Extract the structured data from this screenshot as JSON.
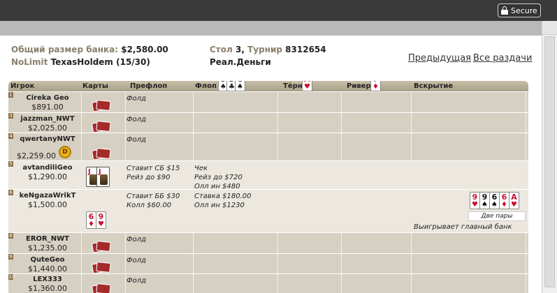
{
  "window": {
    "secure_label": "Secure"
  },
  "header": {
    "pot_label": "Общий размер банка:",
    "pot_value": "$2,580.00",
    "game_label": "NoLimit",
    "game_value": "TexasHoldem (15/30)",
    "table_label": "Стол",
    "table_value": "3,",
    "tournament_label": "Турнир",
    "tournament_value": "8312654",
    "money_type": "Реал.Деньги",
    "prev_link": "Предыдущая",
    "all_link": "Все раздачи"
  },
  "columns": {
    "player": "Игрок",
    "cards": "Карты",
    "preflop": "Префлоп",
    "flop": "Флоп",
    "turn": "Тёрн",
    "river": "Ривер",
    "showdown": "Вскрытие"
  },
  "board": {
    "flop": [
      {
        "v": "9",
        "s": "♠",
        "color": "#111111"
      },
      {
        "v": "3",
        "s": "♣",
        "color": "#111111"
      },
      {
        "v": "6",
        "s": "♠",
        "color": "#111111"
      }
    ],
    "turn": {
      "v": "A",
      "s": "♥",
      "color": "#c8102e"
    },
    "river": {
      "v": "7",
      "s": "♦",
      "color": "#c8102e"
    }
  },
  "players": [
    {
      "seat": "1",
      "name": "Cireka Geo",
      "stack": "$891.00",
      "preflop": "Фолд"
    },
    {
      "seat": "3",
      "name": "jazzman_NWT",
      "stack": "$2,025.00",
      "preflop": "Фолд"
    },
    {
      "seat": "4",
      "name": "qwertanyNWT",
      "stack": "$2,259.00",
      "preflop": "Фолд",
      "dealer": "D"
    },
    {
      "seat": "5",
      "name": "avtandiliGeo",
      "stack": "$1,290.00",
      "preflop_1": "Ставит СБ $15",
      "preflop_2": "Рейз до $90",
      "flop_1": "Чек",
      "flop_2": "Рейз до $720",
      "flop_3": "Олл ин $480",
      "hole": [
        {
          "v": "J"
        },
        {
          "v": "J"
        }
      ]
    },
    {
      "seat": "6",
      "name": "keNgazaWrikT",
      "stack": "$1,500.00",
      "preflop_1": "Ставит ББ $30",
      "preflop_2": "Колл $60.00",
      "flop_1": "Ставка $180.00",
      "flop_2": "Олл ин $1230",
      "hole": [
        {
          "v": "6",
          "s": "♦",
          "color": "#c8102e"
        },
        {
          "v": "9",
          "s": "♥",
          "color": "#c8102e"
        }
      ],
      "showdown_cards": [
        {
          "v": "9",
          "s": "♥",
          "color": "#c8102e"
        },
        {
          "v": "9",
          "s": "♠",
          "color": "#111111"
        },
        {
          "v": "6",
          "s": "♠",
          "color": "#111111"
        },
        {
          "v": "6",
          "s": "♦",
          "color": "#c8102e"
        },
        {
          "v": "A",
          "s": "♥",
          "color": "#c8102e"
        }
      ],
      "combo": "Две пары",
      "result": "Выигрывает главный банк"
    },
    {
      "seat": "8",
      "name": "EROR_NWT",
      "stack": "$1,235.00",
      "preflop": "Фолд"
    },
    {
      "seat": "9",
      "name": "QuteGeo",
      "stack": "$1,440.00",
      "preflop": "Фолд"
    },
    {
      "seat": "10",
      "name": "LEX333",
      "stack": "$1,360.00",
      "preflop": "Фолд"
    }
  ]
}
